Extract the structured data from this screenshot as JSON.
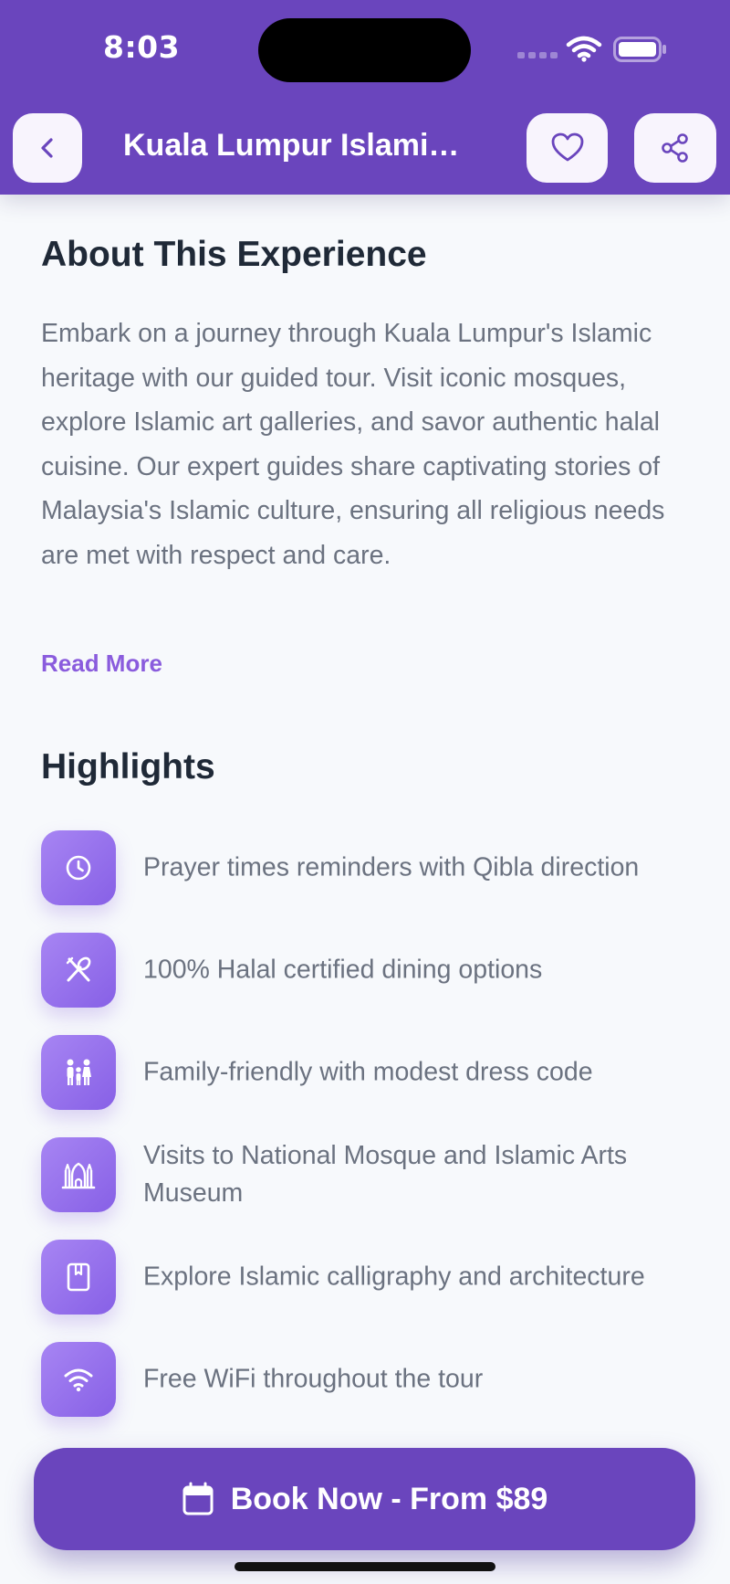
{
  "status_bar": {
    "time": "8:03"
  },
  "header": {
    "title": "Kuala Lumpur Islamic Heritage Tour",
    "back_icon": "chevron-left-icon",
    "favorite_icon": "heart-icon",
    "share_icon": "share-icon"
  },
  "about": {
    "title": "About This Experience",
    "description": "Embark on a journey through Kuala Lumpur's Islamic heritage with our guided tour. Visit iconic mosques, explore Islamic art galleries, and savor authentic halal cuisine. Our expert guides share captivating stories of Malaysia's Islamic culture, ensuring all religious needs are met with respect and care.",
    "read_more": "Read More"
  },
  "highlights": {
    "title": "Highlights",
    "items": [
      {
        "icon": "clock-icon",
        "text": "Prayer times reminders with Qibla direction"
      },
      {
        "icon": "utensils-icon",
        "text": "100% Halal certified dining options"
      },
      {
        "icon": "family-icon",
        "text": "Family-friendly with modest dress code"
      },
      {
        "icon": "mosque-icon",
        "text": "Visits to National Mosque and Islamic Arts Museum"
      },
      {
        "icon": "book-icon",
        "text": "Explore Islamic calligraphy and architecture"
      },
      {
        "icon": "wifi-icon",
        "text": "Free WiFi throughout the tour"
      }
    ]
  },
  "booking": {
    "label": "Book Now - From $89",
    "icon": "calendar-icon"
  },
  "colors": {
    "brand_purple": "#6a45bd",
    "accent_purple": "#8a5cdd",
    "background": "#f7f9fc",
    "body_text": "#6b7280",
    "heading_text": "#1f2937"
  }
}
